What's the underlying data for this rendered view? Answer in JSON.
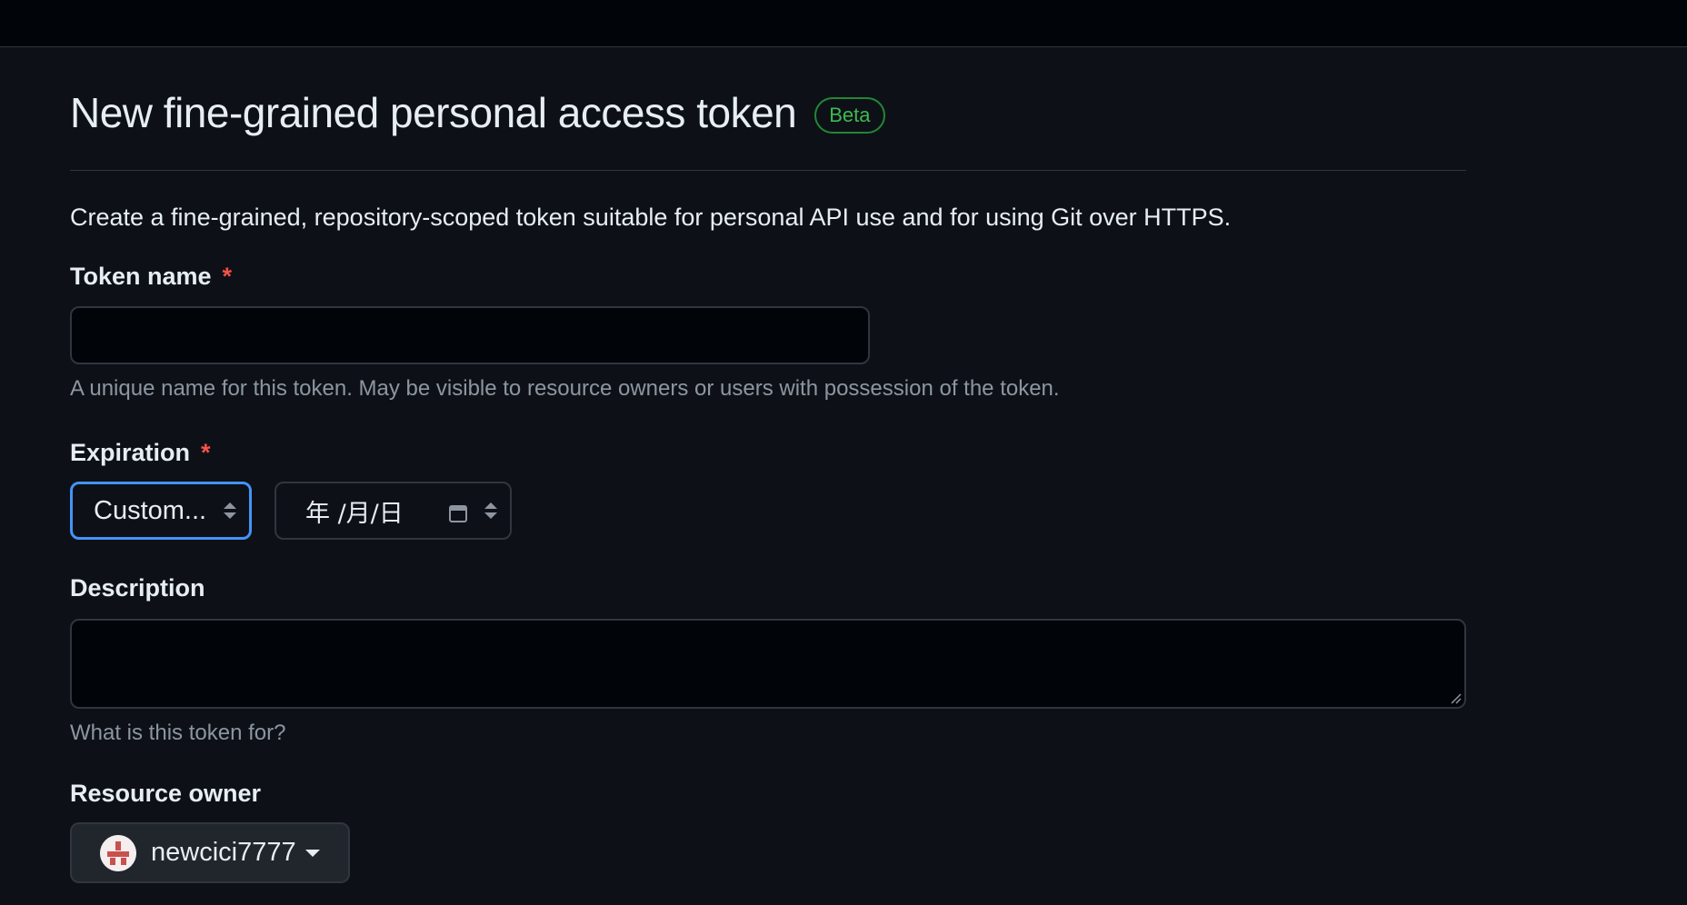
{
  "page": {
    "title": "New fine-grained personal access token",
    "badge": "Beta",
    "lead": "Create a fine-grained, repository-scoped token suitable for personal API use and for using Git over HTTPS."
  },
  "token_name": {
    "label": "Token name",
    "required_mark": "*",
    "value": "",
    "hint": "A unique name for this token. May be visible to resource owners or users with possession of the token."
  },
  "expiration": {
    "label": "Expiration",
    "required_mark": "*",
    "selected": "Custom...",
    "date_placeholder": "年 /月/日"
  },
  "description": {
    "label": "Description",
    "value": "",
    "hint": "What is this token for?"
  },
  "resource_owner": {
    "label": "Resource owner",
    "selected": "newcici7777",
    "avatar_icon": "identicon-avatar"
  },
  "colors": {
    "background": "#0d1117",
    "accent_focus": "#4493f8",
    "badge_green": "#3fb950",
    "required_red": "#f85149",
    "muted_text": "#8d96a0"
  }
}
